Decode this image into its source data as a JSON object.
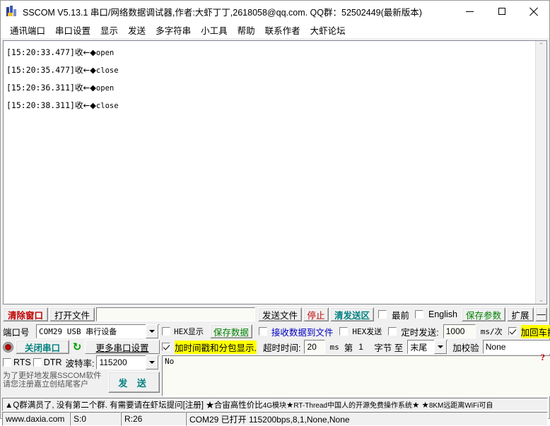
{
  "window": {
    "title": "SSCOM V5.13.1 串口/网络数据调试器,作者:大虾丁丁,2618058@qq.com. QQ群：52502449(最新版本)",
    "minimize": "–",
    "maximize": "□",
    "close": "✕"
  },
  "menu": {
    "items": [
      {
        "label": "通讯端口"
      },
      {
        "label": "串口设置"
      },
      {
        "label": "显示"
      },
      {
        "label": "发送"
      },
      {
        "label": "多字符串"
      },
      {
        "label": "小工具"
      },
      {
        "label": "帮助"
      },
      {
        "label": "联系作者"
      },
      {
        "label": "大虾论坛"
      }
    ]
  },
  "log": {
    "lines": [
      {
        "timestamp": "[15:20:33.477]",
        "direction": "收",
        "arrow": "←◆",
        "payload": "open"
      },
      {
        "timestamp": "[15:20:35.477]",
        "direction": "收",
        "arrow": "←◆",
        "payload": "close"
      },
      {
        "timestamp": "[15:20:36.311]",
        "direction": "收",
        "arrow": "←◆",
        "payload": "open"
      },
      {
        "timestamp": "[15:20:38.311]",
        "direction": "收",
        "arrow": "←◆",
        "payload": "close"
      }
    ],
    "scroll_up": "⌃",
    "scroll_down": "⌄"
  },
  "toolbar": {
    "clear_window": "清除窗口",
    "open_file": "打开文件",
    "file_path": "",
    "send_file": "发送文件",
    "stop": "停止",
    "clear_send": "清发送区",
    "topmost_label": "最前",
    "topmost_checked": false,
    "english_label": "English",
    "english_checked": false,
    "save_params": "保存参数",
    "extend": "扩展",
    "collapse": "—"
  },
  "settings": {
    "port_label": "端口号",
    "port_value": "COM29 USB 串行设备",
    "close_port": "关闭串口",
    "refresh_icon": "refresh-icon",
    "more_port_settings": "更多串口设置",
    "rts_label": "RTS",
    "rts_checked": false,
    "dtr_label": "DTR",
    "dtr_checked": false,
    "baud_label": "波特率:",
    "baud_value": "115200",
    "hex_display_label": "HEX显示",
    "hex_display_checked": false,
    "save_data": "保存数据",
    "recv_to_file_label": "接收数据到文件",
    "recv_to_file_checked": false,
    "hex_send_label": "HEX发送",
    "hex_send_checked": false,
    "timed_send_label": "定时发送:",
    "timed_send_checked": false,
    "timed_send_value": "1000",
    "timed_send_unit": "ms/次",
    "crlf_label": "加回车换行",
    "crlf_checked": true,
    "timestamp_label": "加时间戳和分包显示.",
    "timestamp_checked": true,
    "timeout_label": "超时时间:",
    "timeout_value": "20",
    "timeout_unit": "ms",
    "byte_from_label": "第",
    "byte_from_value": "1",
    "byte_label": "字节 至",
    "byte_to_value": "末尾",
    "checksum_label": "加校验",
    "checksum_value": "None",
    "help_icon": "?"
  },
  "send": {
    "promo_line1": "为了更好地发展SSCOM软件",
    "promo_line2": "请您注册嘉立创结尾客户",
    "send_button": "发 送",
    "textarea_value": "No"
  },
  "ad": {
    "text_1": "▲Q群满员了, 没有第二个群. 有需要请在虾坛提问[注册] ★合宙高性价比",
    "text_2": "4G模块",
    "text_3": " ★",
    "text_4": "RT-Thread中国人的开源免费操作系统",
    "text_5": " ★ ★",
    "text_6": "8KM远距离WiFi可自"
  },
  "status": {
    "site": "www.daxia.com",
    "sent": "S:0",
    "received": "R:26",
    "connection": "COM29 已打开  115200bps,8,1,None,None"
  },
  "colors": {
    "red": "#c00000",
    "teal": "#008080",
    "green": "#008000",
    "blue": "#0000c0",
    "highlight": "#ffff00"
  }
}
